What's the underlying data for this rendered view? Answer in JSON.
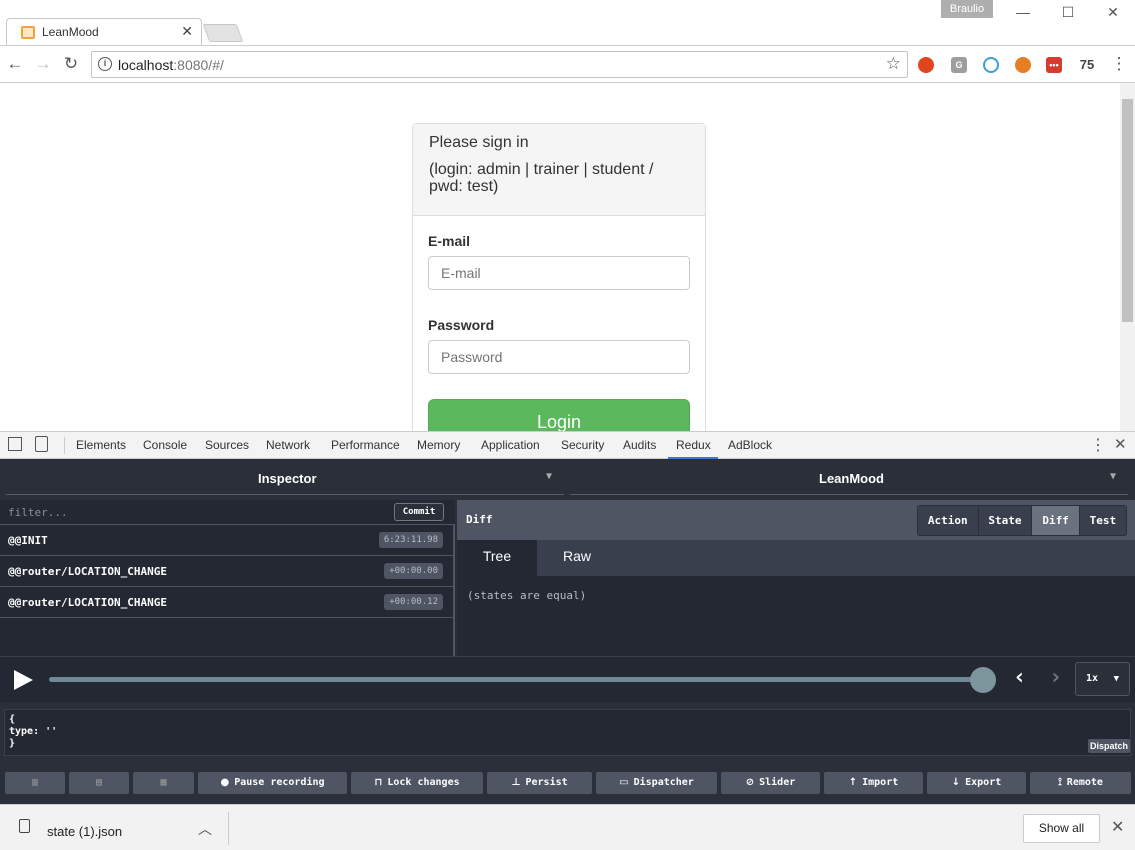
{
  "browser": {
    "tab_title": "LeanMood",
    "profile_name": "Braulio",
    "url_host": "localhost",
    "url_rest": ":8080/#/",
    "extension_badge": "75"
  },
  "login": {
    "heading": "Please sign in",
    "hint": "(login: admin | trainer | student / pwd: test)",
    "email_label": "E-mail",
    "email_placeholder": "E-mail",
    "password_label": "Password",
    "password_placeholder": "Password",
    "login_button": "Login"
  },
  "devtools": {
    "tabs": [
      "Elements",
      "Console",
      "Sources",
      "Network",
      "Performance",
      "Memory",
      "Application",
      "Security",
      "Audits",
      "Redux",
      "AdBlock"
    ],
    "active_tab": "Redux"
  },
  "redux": {
    "left_selector": "Inspector",
    "right_selector": "LeanMood",
    "filter_placeholder": "filter...",
    "commit_label": "Commit",
    "actions": [
      {
        "name": "@@INIT",
        "time": "6:23:11.98"
      },
      {
        "name": "@@router/LOCATION_CHANGE",
        "time": "+00:00.00"
      },
      {
        "name": "@@router/LOCATION_CHANGE",
        "time": "+00:00.12"
      }
    ],
    "panel_title": "Diff",
    "mode_buttons": [
      "Action",
      "State",
      "Diff",
      "Test"
    ],
    "active_mode": "Diff",
    "subtabs": [
      "Tree",
      "Raw"
    ],
    "active_subtab": "Tree",
    "diff_message": "(states are equal)",
    "speed": "1x",
    "dispatch_code": "{\ntype: ''\n}",
    "dispatch_label": "Dispatch",
    "bottom_buttons": {
      "pause": "Pause recording",
      "lock": "Lock changes",
      "persist": "Persist",
      "dispatcher": "Dispatcher",
      "slider": "Slider",
      "import": "Import",
      "export": "Export",
      "remote": "Remote"
    }
  },
  "downloads": {
    "file_name": "state (1).json",
    "show_all": "Show all"
  }
}
